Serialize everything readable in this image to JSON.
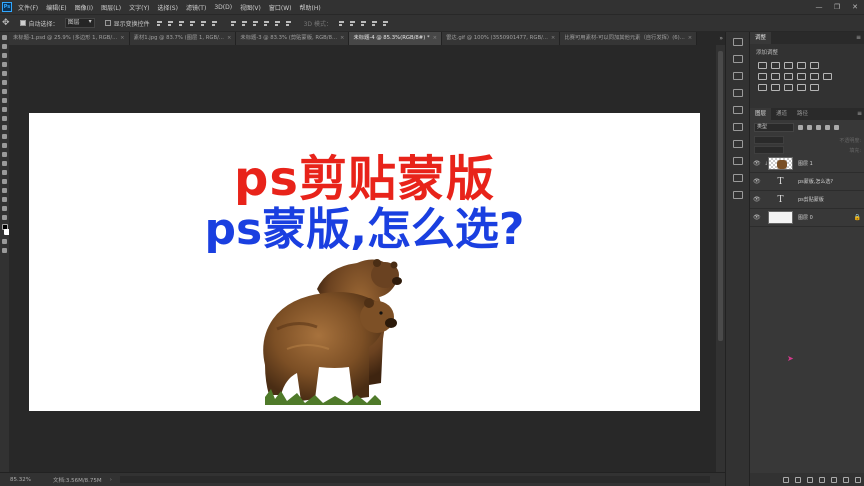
{
  "app": {
    "logo_text": "Ps",
    "menu": [
      "文件(F)",
      "编辑(E)",
      "图像(I)",
      "图层(L)",
      "文字(Y)",
      "选择(S)",
      "滤镜(T)",
      "3D(D)",
      "视图(V)",
      "窗口(W)",
      "帮助(H)"
    ],
    "window_controls": [
      "—",
      "❐",
      "✕"
    ]
  },
  "options": {
    "auto_select_label": "自动选择：",
    "auto_select_value": "图层",
    "show_transform_label": "显示变换控件",
    "mode3d_label": "3D 模式："
  },
  "tabs": [
    {
      "label": "未标题-1.psd @ 25.9% (多边形 1, RGB/...",
      "active": false
    },
    {
      "label": "素材1.jpg @ 83.7% (图层 1, RGB/...",
      "active": false
    },
    {
      "label": "未标题-3 @ 83.3% (剪贴蒙版, RGB/8...",
      "active": false
    },
    {
      "label": "未标题-4 @ 85.3%(RGB/8#) *",
      "active": true
    },
    {
      "label": "雷达.gif @ 100% (3550901477, RGB/...",
      "active": false
    },
    {
      "label": "比赛可用素材-可以同加其他元素（自行发挥）(6)...",
      "active": false
    }
  ],
  "canvas": {
    "title_line1": "ps剪贴蒙版",
    "title_line2": "ps蒙版,怎么选?",
    "title1_color": "#e8231a",
    "title2_color": "#1a3fe0"
  },
  "status": {
    "zoom": "85.32%",
    "doc": "文档:3.56M/8.75M",
    "arrow": "›"
  },
  "adjustments": {
    "tab": "调整",
    "add_label": "添加调整"
  },
  "layers_panel": {
    "tabs": [
      "图层",
      "通道",
      "路径"
    ],
    "filter_kind": "类型",
    "opacity_label": "不透明度:",
    "fill_label": "填充:",
    "layers": [
      {
        "name": "图层 1",
        "type": "image",
        "clipped": true,
        "selected": false
      },
      {
        "name": "ps蒙版,怎么选?",
        "type": "text",
        "selected": false
      },
      {
        "name": "ps剪贴蒙版",
        "type": "text",
        "selected": false
      },
      {
        "name": "图层 0",
        "type": "fill",
        "selected": false,
        "locked": true
      }
    ]
  }
}
